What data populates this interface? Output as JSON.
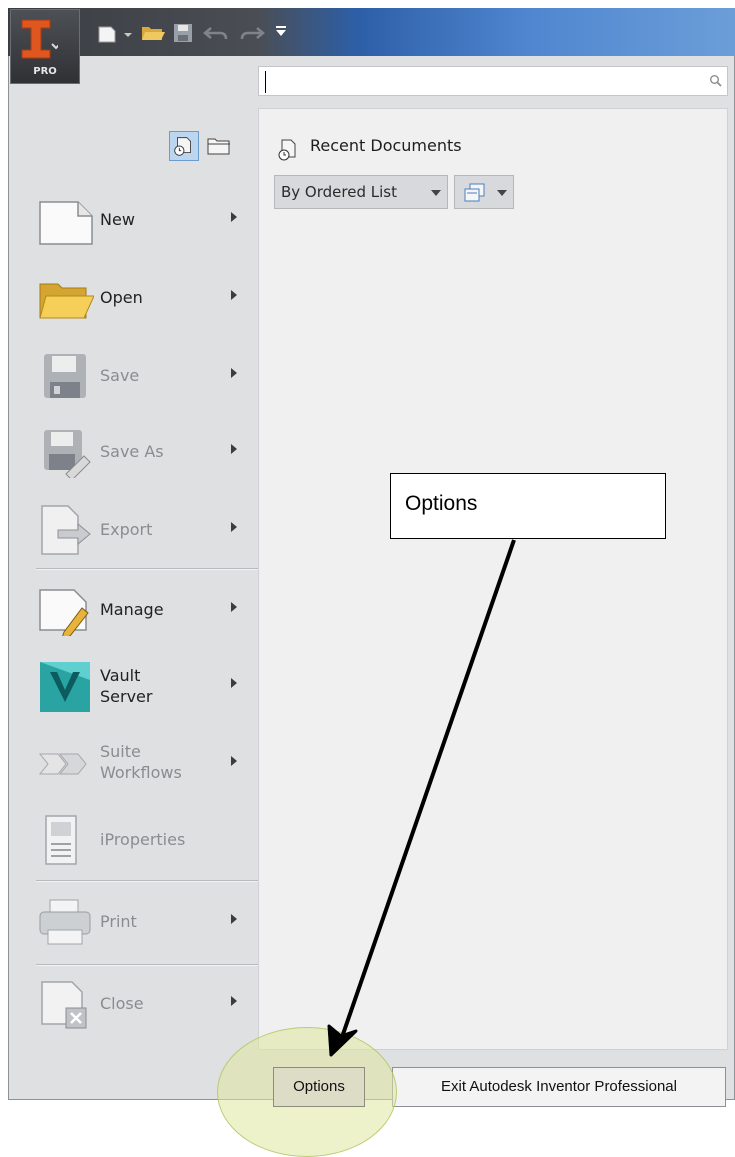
{
  "app": {
    "badge": "PRO",
    "logo_letter": "I"
  },
  "quick_access": {
    "icons": [
      "new-icon",
      "new-dropdown-icon",
      "open-icon",
      "save-icon",
      "undo-icon",
      "redo-icon",
      "customize-dropdown-icon"
    ]
  },
  "search": {
    "value": "",
    "placeholder": ""
  },
  "left_menu": {
    "items": [
      {
        "label": "New",
        "enabled": true,
        "has_submenu": true
      },
      {
        "label": "Open",
        "enabled": true,
        "has_submenu": true
      },
      {
        "label": "Save",
        "enabled": false,
        "has_submenu": true
      },
      {
        "label": "Save As",
        "enabled": false,
        "has_submenu": true
      },
      {
        "label": "Export",
        "enabled": false,
        "has_submenu": true
      },
      {
        "label": "Manage",
        "enabled": true,
        "has_submenu": true
      },
      {
        "label": "Vault\nServer",
        "line1": "Vault",
        "line2": "Server",
        "enabled": true,
        "has_submenu": true
      },
      {
        "label": "Suite\nWorkflows",
        "line1": "Suite",
        "line2": "Workflows",
        "enabled": false,
        "has_submenu": true
      },
      {
        "label": "iProperties",
        "enabled": false,
        "has_submenu": false
      },
      {
        "label": "Print",
        "enabled": false,
        "has_submenu": true
      },
      {
        "label": "Close",
        "enabled": false,
        "has_submenu": true
      }
    ]
  },
  "recent": {
    "title": "Recent Documents",
    "sort_value": "By Ordered List"
  },
  "footer": {
    "options_label": "Options",
    "exit_label": "Exit Autodesk Inventor Professional"
  },
  "annotation": {
    "callout_text": "Options"
  },
  "colors": {
    "panel_bg": "#dfe0e2",
    "pane_bg": "#f0f0f0",
    "highlight": "#dee7a0",
    "logo_orange": "#e0561f"
  }
}
